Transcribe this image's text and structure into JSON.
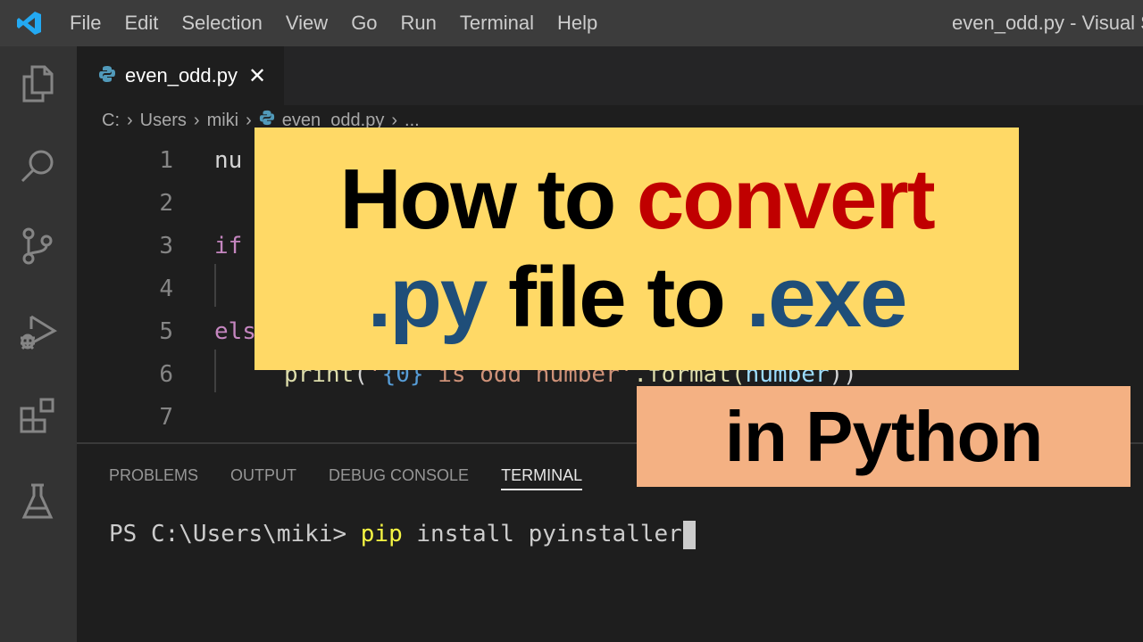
{
  "titlebar": {
    "menu": [
      "File",
      "Edit",
      "Selection",
      "View",
      "Go",
      "Run",
      "Terminal",
      "Help"
    ],
    "window_title": "even_odd.py - Visual St"
  },
  "activity_bar": {
    "icons": [
      "explorer-icon",
      "search-icon",
      "source-control-icon",
      "run-debug-icon",
      "extensions-icon",
      "testing-icon"
    ]
  },
  "tabs": [
    {
      "label": "even_odd.py",
      "icon": "python-icon",
      "active": true
    }
  ],
  "breadcrumb": [
    "C:",
    "Users",
    "miki",
    "even_odd.py",
    "..."
  ],
  "editor": {
    "lines": [
      {
        "num": "1",
        "text": "nu"
      },
      {
        "num": "2",
        "text": ""
      },
      {
        "num": "3",
        "text": "if"
      },
      {
        "num": "4",
        "text": ""
      },
      {
        "num": "5",
        "text": "els"
      },
      {
        "num": "6",
        "text": "print('{0} is odd number'.format(number))"
      },
      {
        "num": "7",
        "text": ""
      }
    ],
    "line6_parts": {
      "fn": "print",
      "open": "(",
      "str_start": "'",
      "brace": "{0}",
      "str_rest": " is odd number'",
      "method": ".format(",
      "var": "number",
      "close": "))"
    }
  },
  "panel": {
    "tabs": [
      {
        "label": "PROBLEMS",
        "active": false
      },
      {
        "label": "OUTPUT",
        "active": false
      },
      {
        "label": "DEBUG CONSOLE",
        "active": false
      },
      {
        "label": "TERMINAL",
        "active": true
      }
    ],
    "terminal": {
      "prompt": "PS C:\\Users\\miki> ",
      "command": "pip",
      "args": " install pyinstaller"
    }
  },
  "overlay": {
    "line1_black": "How to ",
    "line1_red": "convert",
    "line2_blue1": ".py",
    "line2_black": " file to ",
    "line2_blue2": ".exe",
    "sub": "in Python",
    "colors": {
      "yellow_bg": "#ffd966",
      "orange_bg": "#f4b183",
      "red": "#c00000",
      "blue": "#1f4e79"
    }
  }
}
